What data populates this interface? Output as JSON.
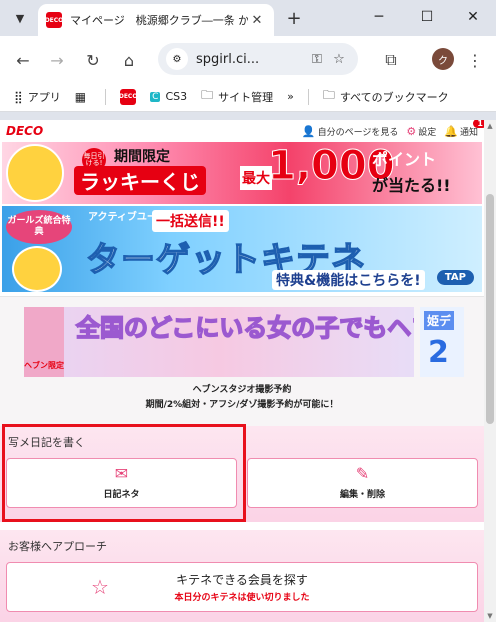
{
  "browser": {
    "tab_title": "マイページ　桃源郷クラブ―一条 かく",
    "tab_favicon_text": "DECO",
    "url": "spgirl.ci...",
    "profile_initial": "ク",
    "bookmarks": [
      {
        "icon": "apps-grid-icon",
        "label": "アプリ"
      },
      {
        "icon": "grid-icon",
        "label": ""
      },
      {
        "icon": "deco-favicon",
        "label": ""
      },
      {
        "icon": "cs3-icon",
        "label": "CS3"
      },
      {
        "icon": "folder-icon",
        "label": "サイト管理"
      },
      {
        "icon": "folder-icon",
        "label": "すべてのブックマーク"
      }
    ],
    "more_bookmarks": "»"
  },
  "header": {
    "logo": "DECO",
    "mypage_link": "自分のページを見る",
    "settings_link": "設定",
    "notice_link": "通知",
    "notice_count": "1"
  },
  "banner_lucky": {
    "tag": "毎日引ける!",
    "line1": "期間限定",
    "line2": "ラッキーくじ",
    "max": "最大",
    "amount": "1,000",
    "points": "ポイント",
    "win": "が当たる!!"
  },
  "banner_target": {
    "tag": "ガールズ統合特典",
    "sub": "アクティブユーザに",
    "send": "一括送信!!",
    "title": "ターゲットキテネ",
    "feature": "特典&機能はこちらを!",
    "tap": "TAP"
  },
  "banner_studio": {
    "text": "全国のどこにいる女の子でもヘブンスタジオが無料で使える",
    "side": "ヘブン限定",
    "right_tag": "姫デ",
    "right_num": "2",
    "caption": "ヘブンスタジオ撮影予約",
    "caption2": "期間/2%組対・アフシ/ダゾ撮影予約が可能に！"
  },
  "diary": {
    "title": "写メ日記を書く",
    "buttons": [
      {
        "icon": "message-icon",
        "label": "日記ネタ"
      },
      {
        "icon": "edit-icon",
        "label": "編集・削除"
      }
    ]
  },
  "approach": {
    "title": "お客様へアプローチ",
    "button_label": "キテネできる会員を探す",
    "button_note": "本日分のキテネは使い切りました"
  }
}
